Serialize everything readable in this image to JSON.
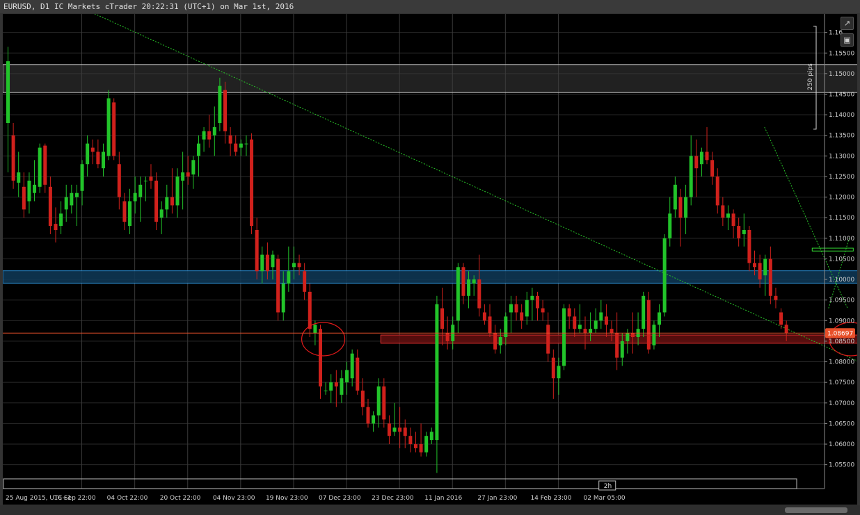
{
  "window": {
    "title": "EURUSD, D1 IC Markets cTrader 20:22:31 (UTC+1) on Mar 1st, 2016"
  },
  "toolbar": {
    "popout_icon": "popout-icon",
    "screenshot_icon": "camera-icon"
  },
  "colors": {
    "background": "#000000",
    "bull": "#22c42a",
    "bear": "#d0211c",
    "grid": "#2a2a2a",
    "axis_text": "#d0d0d0",
    "price_line": "#e8502a",
    "trend": "#28c428",
    "zone_grey": "#3c3c3c",
    "zone_blue": "#0f3a58",
    "zone_red": "#6a1010"
  },
  "chart_data": {
    "type": "candlestick",
    "symbol": "EURUSD",
    "timeframe": "D1",
    "ylim": [
      1.0492,
      1.1645
    ],
    "y_ticks": [
      1.055,
      1.06,
      1.065,
      1.07,
      1.075,
      1.08,
      1.085,
      1.09,
      1.095,
      1.1,
      1.105,
      1.11,
      1.115,
      1.12,
      1.125,
      1.13,
      1.135,
      1.14,
      1.145,
      1.15,
      1.155,
      1.16
    ],
    "y_tick_labels": [
      "1.05500",
      "1.06000",
      "1.06500",
      "1.07000",
      "1.07500",
      "1.08000",
      "1.08500",
      "1.09000",
      "1.09500",
      "1.10000",
      "1.10500",
      "1.11000",
      "1.11500",
      "1.12000",
      "1.12500",
      "1.13000",
      "1.13500",
      "1.14000",
      "1.14500",
      "1.15000",
      "1.15500",
      "1.16"
    ],
    "x_labels": [
      {
        "index": 0,
        "label": "25 Aug 2015, UTC+1"
      },
      {
        "index": 14,
        "label": "16 Sep 22:00"
      },
      {
        "index": 24,
        "label": "04 Oct 22:00"
      },
      {
        "index": 34,
        "label": "20 Oct 22:00"
      },
      {
        "index": 44,
        "label": "04 Nov 23:00"
      },
      {
        "index": 54,
        "label": "19 Nov 23:00"
      },
      {
        "index": 64,
        "label": "07 Dec 23:00"
      },
      {
        "index": 74,
        "label": "23 Dec 23:00"
      },
      {
        "index": 84,
        "label": "11 Jan 2016"
      },
      {
        "index": 94,
        "label": "27 Jan 23:00"
      },
      {
        "index": 104,
        "label": "14 Feb 23:00"
      },
      {
        "index": 114,
        "label": "02 Mar 05:00"
      }
    ],
    "vertical_grid_index": [
      14,
      24,
      34,
      44,
      54,
      64,
      74,
      84,
      94,
      104
    ],
    "current_price": 1.08697,
    "current_price_label": "1.08697",
    "range_marker_label": "250 pips",
    "range_marker": [
      1.1365,
      1.1615
    ],
    "time_marker_label": "2h",
    "time_marker_index": 113.5,
    "candles": [
      {
        "o": 1.138,
        "h": 1.1565,
        "l": 1.126,
        "c": 1.153
      },
      {
        "o": 1.135,
        "h": 1.138,
        "l": 1.122,
        "c": 1.124
      },
      {
        "o": 1.1235,
        "h": 1.131,
        "l": 1.12,
        "c": 1.126
      },
      {
        "o": 1.1225,
        "h": 1.126,
        "l": 1.115,
        "c": 1.117
      },
      {
        "o": 1.119,
        "h": 1.126,
        "l": 1.116,
        "c": 1.124
      },
      {
        "o": 1.121,
        "h": 1.129,
        "l": 1.119,
        "c": 1.123
      },
      {
        "o": 1.1225,
        "h": 1.133,
        "l": 1.121,
        "c": 1.132
      },
      {
        "o": 1.1325,
        "h": 1.133,
        "l": 1.121,
        "c": 1.123
      },
      {
        "o": 1.1225,
        "h": 1.125,
        "l": 1.111,
        "c": 1.113
      },
      {
        "o": 1.1135,
        "h": 1.1175,
        "l": 1.109,
        "c": 1.112
      },
      {
        "o": 1.113,
        "h": 1.119,
        "l": 1.111,
        "c": 1.116
      },
      {
        "o": 1.117,
        "h": 1.123,
        "l": 1.114,
        "c": 1.12
      },
      {
        "o": 1.118,
        "h": 1.123,
        "l": 1.116,
        "c": 1.121
      },
      {
        "o": 1.12,
        "h": 1.123,
        "l": 1.113,
        "c": 1.121
      },
      {
        "o": 1.1215,
        "h": 1.129,
        "l": 1.118,
        "c": 1.128
      },
      {
        "o": 1.128,
        "h": 1.135,
        "l": 1.125,
        "c": 1.133
      },
      {
        "o": 1.132,
        "h": 1.134,
        "l": 1.128,
        "c": 1.131
      },
      {
        "o": 1.131,
        "h": 1.134,
        "l": 1.127,
        "c": 1.128
      },
      {
        "o": 1.127,
        "h": 1.133,
        "l": 1.125,
        "c": 1.131
      },
      {
        "o": 1.13,
        "h": 1.146,
        "l": 1.129,
        "c": 1.144
      },
      {
        "o": 1.143,
        "h": 1.144,
        "l": 1.129,
        "c": 1.13
      },
      {
        "o": 1.128,
        "h": 1.131,
        "l": 1.117,
        "c": 1.12
      },
      {
        "o": 1.119,
        "h": 1.121,
        "l": 1.112,
        "c": 1.114
      },
      {
        "o": 1.113,
        "h": 1.122,
        "l": 1.111,
        "c": 1.119
      },
      {
        "o": 1.119,
        "h": 1.125,
        "l": 1.116,
        "c": 1.121
      },
      {
        "o": 1.12,
        "h": 1.125,
        "l": 1.114,
        "c": 1.123
      },
      {
        "o": 1.124,
        "h": 1.125,
        "l": 1.119,
        "c": 1.124
      },
      {
        "o": 1.125,
        "h": 1.128,
        "l": 1.122,
        "c": 1.124
      },
      {
        "o": 1.124,
        "h": 1.126,
        "l": 1.112,
        "c": 1.114
      },
      {
        "o": 1.115,
        "h": 1.119,
        "l": 1.111,
        "c": 1.117
      },
      {
        "o": 1.117,
        "h": 1.123,
        "l": 1.115,
        "c": 1.12
      },
      {
        "o": 1.12,
        "h": 1.127,
        "l": 1.116,
        "c": 1.118
      },
      {
        "o": 1.118,
        "h": 1.127,
        "l": 1.115,
        "c": 1.125
      },
      {
        "o": 1.124,
        "h": 1.131,
        "l": 1.117,
        "c": 1.126
      },
      {
        "o": 1.126,
        "h": 1.13,
        "l": 1.123,
        "c": 1.125
      },
      {
        "o": 1.1255,
        "h": 1.13,
        "l": 1.122,
        "c": 1.129
      },
      {
        "o": 1.13,
        "h": 1.135,
        "l": 1.125,
        "c": 1.133
      },
      {
        "o": 1.134,
        "h": 1.137,
        "l": 1.131,
        "c": 1.136
      },
      {
        "o": 1.136,
        "h": 1.14,
        "l": 1.132,
        "c": 1.134
      },
      {
        "o": 1.135,
        "h": 1.142,
        "l": 1.13,
        "c": 1.137
      },
      {
        "o": 1.138,
        "h": 1.149,
        "l": 1.136,
        "c": 1.147
      },
      {
        "o": 1.146,
        "h": 1.148,
        "l": 1.133,
        "c": 1.136
      },
      {
        "o": 1.135,
        "h": 1.137,
        "l": 1.13,
        "c": 1.133
      },
      {
        "o": 1.133,
        "h": 1.135,
        "l": 1.13,
        "c": 1.131
      },
      {
        "o": 1.132,
        "h": 1.134,
        "l": 1.13,
        "c": 1.133
      },
      {
        "o": 1.133,
        "h": 1.135,
        "l": 1.13,
        "c": 1.133
      },
      {
        "o": 1.134,
        "h": 1.1355,
        "l": 1.111,
        "c": 1.113
      },
      {
        "o": 1.112,
        "h": 1.115,
        "l": 1.1,
        "c": 1.102
      },
      {
        "o": 1.102,
        "h": 1.108,
        "l": 1.099,
        "c": 1.106
      },
      {
        "o": 1.106,
        "h": 1.109,
        "l": 1.1,
        "c": 1.102
      },
      {
        "o": 1.103,
        "h": 1.107,
        "l": 1.1,
        "c": 1.106
      },
      {
        "o": 1.105,
        "h": 1.106,
        "l": 1.09,
        "c": 1.092
      },
      {
        "o": 1.092,
        "h": 1.102,
        "l": 1.09,
        "c": 1.099
      },
      {
        "o": 1.099,
        "h": 1.108,
        "l": 1.097,
        "c": 1.102
      },
      {
        "o": 1.103,
        "h": 1.108,
        "l": 1.1,
        "c": 1.104
      },
      {
        "o": 1.104,
        "h": 1.106,
        "l": 1.101,
        "c": 1.103
      },
      {
        "o": 1.102,
        "h": 1.104,
        "l": 1.095,
        "c": 1.097
      },
      {
        "o": 1.097,
        "h": 1.099,
        "l": 1.086,
        "c": 1.088
      },
      {
        "o": 1.087,
        "h": 1.09,
        "l": 1.084,
        "c": 1.089
      },
      {
        "o": 1.088,
        "h": 1.089,
        "l": 1.071,
        "c": 1.074
      },
      {
        "o": 1.073,
        "h": 1.075,
        "l": 1.072,
        "c": 1.073
      },
      {
        "o": 1.073,
        "h": 1.077,
        "l": 1.07,
        "c": 1.075
      },
      {
        "o": 1.075,
        "h": 1.078,
        "l": 1.069,
        "c": 1.074
      },
      {
        "o": 1.072,
        "h": 1.078,
        "l": 1.07,
        "c": 1.076
      },
      {
        "o": 1.075,
        "h": 1.08,
        "l": 1.072,
        "c": 1.078
      },
      {
        "o": 1.076,
        "h": 1.083,
        "l": 1.074,
        "c": 1.082
      },
      {
        "o": 1.081,
        "h": 1.083,
        "l": 1.072,
        "c": 1.073
      },
      {
        "o": 1.073,
        "h": 1.076,
        "l": 1.067,
        "c": 1.069
      },
      {
        "o": 1.069,
        "h": 1.071,
        "l": 1.064,
        "c": 1.065
      },
      {
        "o": 1.065,
        "h": 1.068,
        "l": 1.063,
        "c": 1.067
      },
      {
        "o": 1.067,
        "h": 1.076,
        "l": 1.064,
        "c": 1.074
      },
      {
        "o": 1.074,
        "h": 1.076,
        "l": 1.064,
        "c": 1.066
      },
      {
        "o": 1.065,
        "h": 1.067,
        "l": 1.06,
        "c": 1.062
      },
      {
        "o": 1.063,
        "h": 1.07,
        "l": 1.062,
        "c": 1.064
      },
      {
        "o": 1.064,
        "h": 1.069,
        "l": 1.059,
        "c": 1.063
      },
      {
        "o": 1.064,
        "h": 1.066,
        "l": 1.059,
        "c": 1.062
      },
      {
        "o": 1.062,
        "h": 1.064,
        "l": 1.058,
        "c": 1.06
      },
      {
        "o": 1.06,
        "h": 1.063,
        "l": 1.058,
        "c": 1.059
      },
      {
        "o": 1.06,
        "h": 1.065,
        "l": 1.057,
        "c": 1.058
      },
      {
        "o": 1.058,
        "h": 1.063,
        "l": 1.057,
        "c": 1.062
      },
      {
        "o": 1.061,
        "h": 1.064,
        "l": 1.06,
        "c": 1.063
      },
      {
        "o": 1.061,
        "h": 1.096,
        "l": 1.053,
        "c": 1.094
      },
      {
        "o": 1.093,
        "h": 1.098,
        "l": 1.084,
        "c": 1.088
      },
      {
        "o": 1.087,
        "h": 1.091,
        "l": 1.083,
        "c": 1.085
      },
      {
        "o": 1.085,
        "h": 1.091,
        "l": 1.083,
        "c": 1.089
      },
      {
        "o": 1.09,
        "h": 1.104,
        "l": 1.087,
        "c": 1.103
      },
      {
        "o": 1.103,
        "h": 1.104,
        "l": 1.094,
        "c": 1.096
      },
      {
        "o": 1.096,
        "h": 1.102,
        "l": 1.093,
        "c": 1.1
      },
      {
        "o": 1.099,
        "h": 1.101,
        "l": 1.096,
        "c": 1.1
      },
      {
        "o": 1.1,
        "h": 1.106,
        "l": 1.091,
        "c": 1.093
      },
      {
        "o": 1.092,
        "h": 1.094,
        "l": 1.089,
        "c": 1.09
      },
      {
        "o": 1.091,
        "h": 1.094,
        "l": 1.086,
        "c": 1.087
      },
      {
        "o": 1.087,
        "h": 1.089,
        "l": 1.082,
        "c": 1.083
      },
      {
        "o": 1.084,
        "h": 1.088,
        "l": 1.082,
        "c": 1.086
      },
      {
        "o": 1.086,
        "h": 1.092,
        "l": 1.084,
        "c": 1.091
      },
      {
        "o": 1.092,
        "h": 1.096,
        "l": 1.087,
        "c": 1.094
      },
      {
        "o": 1.094,
        "h": 1.096,
        "l": 1.09,
        "c": 1.092
      },
      {
        "o": 1.092,
        "h": 1.094,
        "l": 1.088,
        "c": 1.09
      },
      {
        "o": 1.091,
        "h": 1.097,
        "l": 1.089,
        "c": 1.095
      },
      {
        "o": 1.095,
        "h": 1.098,
        "l": 1.09,
        "c": 1.096
      },
      {
        "o": 1.096,
        "h": 1.097,
        "l": 1.09,
        "c": 1.093
      },
      {
        "o": 1.093,
        "h": 1.095,
        "l": 1.09,
        "c": 1.092
      },
      {
        "o": 1.089,
        "h": 1.092,
        "l": 1.08,
        "c": 1.082
      },
      {
        "o": 1.081,
        "h": 1.083,
        "l": 1.071,
        "c": 1.076
      },
      {
        "o": 1.076,
        "h": 1.081,
        "l": 1.072,
        "c": 1.079
      },
      {
        "o": 1.079,
        "h": 1.094,
        "l": 1.078,
        "c": 1.093
      },
      {
        "o": 1.093,
        "h": 1.094,
        "l": 1.088,
        "c": 1.091
      },
      {
        "o": 1.091,
        "h": 1.093,
        "l": 1.086,
        "c": 1.088
      },
      {
        "o": 1.088,
        "h": 1.094,
        "l": 1.087,
        "c": 1.089
      },
      {
        "o": 1.088,
        "h": 1.091,
        "l": 1.083,
        "c": 1.087
      },
      {
        "o": 1.087,
        "h": 1.092,
        "l": 1.085,
        "c": 1.088
      },
      {
        "o": 1.088,
        "h": 1.093,
        "l": 1.087,
        "c": 1.09
      },
      {
        "o": 1.09,
        "h": 1.095,
        "l": 1.088,
        "c": 1.092
      },
      {
        "o": 1.091,
        "h": 1.094,
        "l": 1.086,
        "c": 1.089
      },
      {
        "o": 1.088,
        "h": 1.09,
        "l": 1.085,
        "c": 1.087
      },
      {
        "o": 1.087,
        "h": 1.092,
        "l": 1.078,
        "c": 1.081
      },
      {
        "o": 1.081,
        "h": 1.087,
        "l": 1.079,
        "c": 1.085
      },
      {
        "o": 1.085,
        "h": 1.088,
        "l": 1.082,
        "c": 1.087
      },
      {
        "o": 1.087,
        "h": 1.092,
        "l": 1.082,
        "c": 1.086
      },
      {
        "o": 1.086,
        "h": 1.092,
        "l": 1.084,
        "c": 1.088
      },
      {
        "o": 1.088,
        "h": 1.097,
        "l": 1.086,
        "c": 1.096
      },
      {
        "o": 1.095,
        "h": 1.097,
        "l": 1.082,
        "c": 1.083
      },
      {
        "o": 1.084,
        "h": 1.09,
        "l": 1.083,
        "c": 1.089
      },
      {
        "o": 1.089,
        "h": 1.094,
        "l": 1.086,
        "c": 1.092
      },
      {
        "o": 1.092,
        "h": 1.111,
        "l": 1.091,
        "c": 1.11
      },
      {
        "o": 1.11,
        "h": 1.12,
        "l": 1.108,
        "c": 1.116
      },
      {
        "o": 1.117,
        "h": 1.125,
        "l": 1.115,
        "c": 1.123
      },
      {
        "o": 1.12,
        "h": 1.122,
        "l": 1.108,
        "c": 1.115
      },
      {
        "o": 1.115,
        "h": 1.123,
        "l": 1.111,
        "c": 1.12
      },
      {
        "o": 1.12,
        "h": 1.135,
        "l": 1.118,
        "c": 1.13
      },
      {
        "o": 1.13,
        "h": 1.134,
        "l": 1.12,
        "c": 1.127
      },
      {
        "o": 1.128,
        "h": 1.132,
        "l": 1.125,
        "c": 1.131
      },
      {
        "o": 1.131,
        "h": 1.137,
        "l": 1.128,
        "c": 1.129
      },
      {
        "o": 1.129,
        "h": 1.131,
        "l": 1.123,
        "c": 1.125
      },
      {
        "o": 1.125,
        "h": 1.127,
        "l": 1.116,
        "c": 1.118
      },
      {
        "o": 1.118,
        "h": 1.12,
        "l": 1.113,
        "c": 1.115
      },
      {
        "o": 1.115,
        "h": 1.118,
        "l": 1.112,
        "c": 1.116
      },
      {
        "o": 1.116,
        "h": 1.117,
        "l": 1.11,
        "c": 1.113
      },
      {
        "o": 1.113,
        "h": 1.115,
        "l": 1.108,
        "c": 1.11
      },
      {
        "o": 1.111,
        "h": 1.116,
        "l": 1.108,
        "c": 1.112
      },
      {
        "o": 1.112,
        "h": 1.113,
        "l": 1.102,
        "c": 1.104
      },
      {
        "o": 1.104,
        "h": 1.107,
        "l": 1.101,
        "c": 1.103
      },
      {
        "o": 1.104,
        "h": 1.106,
        "l": 1.098,
        "c": 1.1
      },
      {
        "o": 1.101,
        "h": 1.106,
        "l": 1.096,
        "c": 1.105
      },
      {
        "o": 1.105,
        "h": 1.108,
        "l": 1.094,
        "c": 1.096
      },
      {
        "o": 1.096,
        "h": 1.098,
        "l": 1.093,
        "c": 1.095
      },
      {
        "o": 1.092,
        "h": 1.093,
        "l": 1.088,
        "c": 1.089
      },
      {
        "o": 1.089,
        "h": 1.09,
        "l": 1.085,
        "c": 1.087
      }
    ],
    "zones": [
      {
        "name": "grey-upper",
        "from": 1.1454,
        "to": 1.1522,
        "start": 0,
        "end": 1.055
      },
      {
        "name": "blue-mid",
        "from": 1.0991,
        "to": 1.1021,
        "start": 0,
        "end": 1.05
      },
      {
        "name": "red-support",
        "from": 1.0845,
        "to": 1.0865,
        "start": 0.46,
        "end": 1.078
      },
      {
        "name": "green-small",
        "from": 1.1069,
        "to": 1.1076,
        "start": 0.985,
        "end": 1.035
      }
    ],
    "trendlines": [
      {
        "x0": 0.09,
        "y0": 1.1665,
        "x1": 1.13,
        "y1": 1.072
      },
      {
        "x0": 0.927,
        "y0": 1.137,
        "x1": 1.028,
        "y1": 1.093
      },
      {
        "x0": 1.005,
        "y0": 1.093,
        "x1": 1.03,
        "y1": 1.11
      }
    ],
    "circles": [
      {
        "t": 0.39,
        "p": 1.0855
      },
      {
        "t": 1.032,
        "p": 1.0855
      }
    ]
  }
}
